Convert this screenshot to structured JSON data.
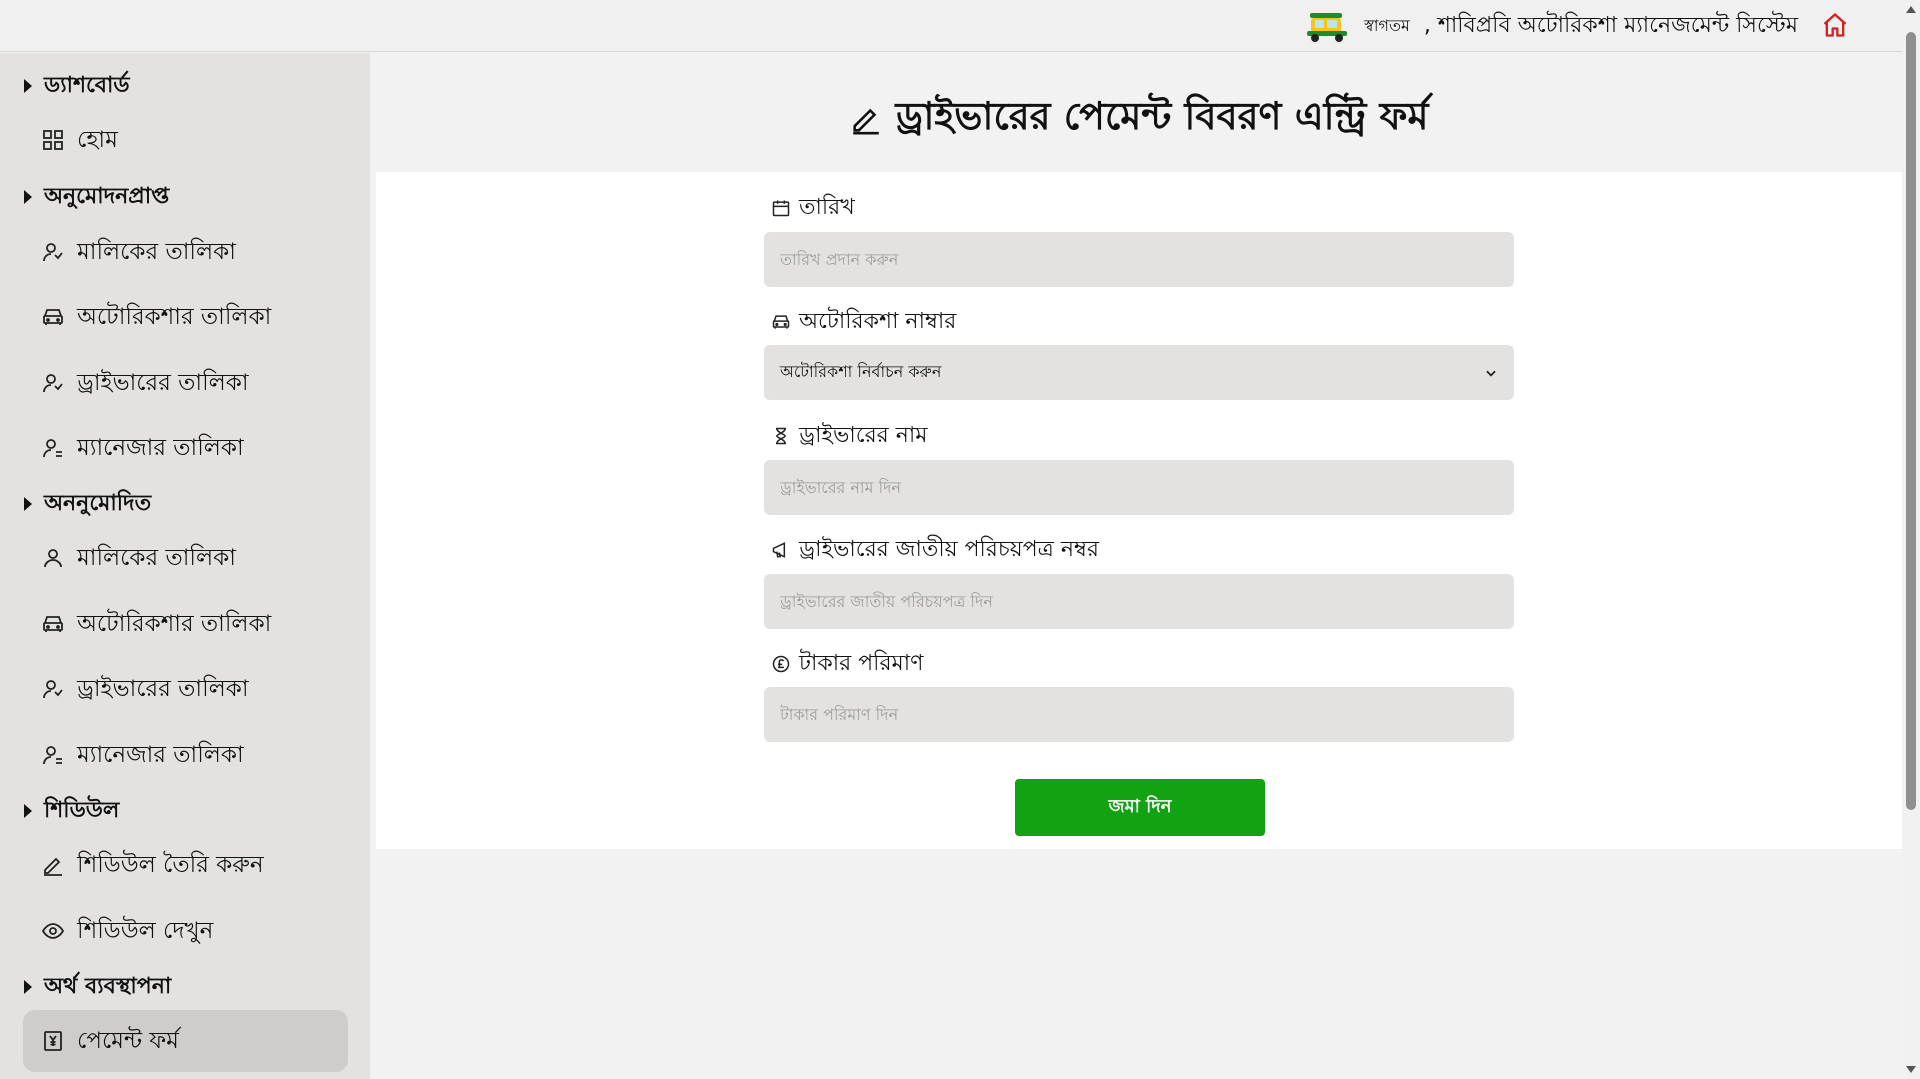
{
  "header": {
    "welcome": "স্বাগতম",
    "title": ", শাবিপ্রবি অটোরিকশা ম্যানেজমেন্ট সিস্টেম",
    "logo_icon": "auto-rickshaw-icon",
    "home_icon": "home-icon"
  },
  "sidebar": {
    "sections": [
      {
        "label": "ড্যাশবোর্ড",
        "items": [
          {
            "label": "হোম",
            "icon": "grid-icon"
          }
        ]
      },
      {
        "label": "অনুমোদনপ্রাপ্ত",
        "items": [
          {
            "label": "মালিকের তালিকা",
            "icon": "users-icon"
          },
          {
            "label": "অটোরিকশার তালিকা",
            "icon": "vehicle-icon"
          },
          {
            "label": "ড্রাইভারের তালিকা",
            "icon": "users-icon"
          },
          {
            "label": "ম্যানেজার তালিকা",
            "icon": "user-list-icon"
          }
        ]
      },
      {
        "label": "অননুমোদিত",
        "items": [
          {
            "label": "মালিকের তালিকা",
            "icon": "user-icon"
          },
          {
            "label": "অটোরিকশার তালিকা",
            "icon": "vehicle-icon"
          },
          {
            "label": "ড্রাইভারের তালিকা",
            "icon": "users-icon"
          },
          {
            "label": "ম্যানেজার তালিকা",
            "icon": "user-list-icon"
          }
        ]
      },
      {
        "label": "শিডিউল",
        "items": [
          {
            "label": "শিডিউল তৈরি করুন",
            "icon": "pencil-icon"
          },
          {
            "label": "শিডিউল দেখুন",
            "icon": "eye-icon"
          }
        ]
      },
      {
        "label": "অর্থ ব্যবস্থাপনা",
        "items": [
          {
            "label": "পেমেন্ট ফর্ম",
            "icon": "yen-receipt-icon",
            "active": true
          }
        ]
      }
    ]
  },
  "form": {
    "title": "ড্রাইভারের পেমেন্ট বিবরণ এন্ট্রি ফর্ম",
    "fields": [
      {
        "label": "তারিখ",
        "placeholder": "তারিখ প্রদান করুন",
        "icon": "calendar-icon"
      },
      {
        "label": "অটোরিকশা নাম্বার",
        "selected": "অটোরিকশা নির্বাচন করুন",
        "icon": "vehicle-icon"
      },
      {
        "label": "ড্রাইভারের নাম",
        "placeholder": "ড্রাইভারের নাম দিন",
        "icon": "hourglass-icon"
      },
      {
        "label": "ড্রাইভারের জাতীয় পরিচয়পত্র নম্বর",
        "placeholder": "ড্রাইভারের জাতীয় পরিচয়পত্র দিন",
        "icon": "megaphone-icon"
      },
      {
        "label": "টাকার পরিমাণ",
        "placeholder": "টাকার পরিমাণ দিন",
        "icon": "pound-coin-icon"
      }
    ],
    "submit_label": "জমা দিন"
  },
  "colors": {
    "accent_green": "#12a312",
    "welcome_red": "#d32020",
    "home_icon_red": "#d32020",
    "sidebar_bg": "#e4e2e1",
    "input_bg": "#e4e2e1"
  }
}
